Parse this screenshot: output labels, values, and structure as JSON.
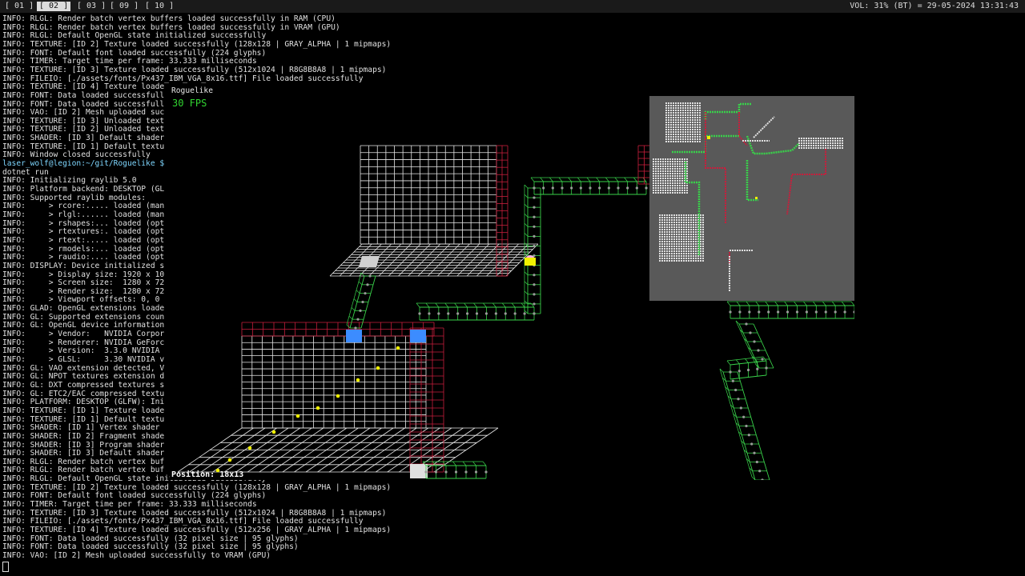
{
  "workspaces": [
    {
      "label": "[ 01 ]",
      "active": false
    },
    {
      "label": "[ 02 ]",
      "active": true
    },
    {
      "label": "[ 03 ]",
      "active": false
    },
    {
      "label": "[ 09 ]",
      "active": false
    },
    {
      "label": "[ 10 ]",
      "active": false
    }
  ],
  "status": "VOL: 31% (BT) = 29-05-2024 13:31:43",
  "terminal": {
    "lines": [
      "INFO: RLGL: Render batch vertex buffers loaded successfully in RAM (CPU)",
      "INFO: RLGL: Render batch vertex buffers loaded successfully in VRAM (GPU)",
      "INFO: RLGL: Default OpenGL state initialized successfully",
      "INFO: TEXTURE: [ID 2] Texture loaded successfully (128x128 | GRAY_ALPHA | 1 mipmaps)",
      "INFO: FONT: Default font loaded successfully (224 glyphs)",
      "INFO: TIMER: Target time per frame: 33.333 milliseconds",
      "INFO: TEXTURE: [ID 3] Texture loaded successfully (512x1024 | R8G8B8A8 | 1 mipmaps)",
      "INFO: FILEIO: [./assets/fonts/Px437_IBM_VGA_8x16.ttf] File loaded successfully",
      "INFO: TEXTURE: [ID 4] Texture loade",
      "INFO: FONT: Data loaded successfull",
      "INFO: FONT: Data loaded successfull",
      "INFO: VAO: [ID 2] Mesh uploaded suc",
      "INFO: TEXTURE: [ID 3] Unloaded text",
      "INFO: TEXTURE: [ID 2] Unloaded text",
      "INFO: SHADER: [ID 3] Default shader",
      "INFO: TEXTURE: [ID 1] Default textu",
      "INFO: Window closed successfully",
      "laser_wolf@legion:~/git/Roguelike $",
      "dotnet run",
      "INFO: Initializing raylib 5.0",
      "INFO: Platform backend: DESKTOP (GL",
      "INFO: Supported raylib modules:",
      "INFO:     > rcore:..... loaded (man",
      "INFO:     > rlgl:...... loaded (man",
      "INFO:     > rshapes:... loaded (opt",
      "INFO:     > rtextures:. loaded (opt",
      "INFO:     > rtext:..... loaded (opt",
      "INFO:     > rmodels:... loaded (opt",
      "INFO:     > raudio:.... loaded (opt",
      "INFO: DISPLAY: Device initialized s",
      "INFO:     > Display size: 1920 x 10",
      "INFO:     > Screen size:  1280 x 72",
      "INFO:     > Render size:  1280 x 72",
      "INFO:     > Viewport offsets: 0, 0",
      "INFO: GLAD: OpenGL extensions loade",
      "INFO: GL: Supported extensions coun",
      "INFO: GL: OpenGL device information",
      "INFO:     > Vendor:   NVIDIA Corpor",
      "INFO:     > Renderer: NVIDIA GeForc",
      "INFO:     > Version:  3.3.0 NVIDIA",
      "INFO:     > GLSL:     3.30 NVIDIA v",
      "INFO: GL: VAO extension detected, V",
      "INFO: GL: NPOT textures extension d",
      "INFO: GL: DXT compressed textures s",
      "INFO: GL: ETC2/EAC compressed textu",
      "INFO: PLATFORM: DESKTOP (GLFW): Ini",
      "INFO: TEXTURE: [ID 1] Texture loade",
      "INFO: TEXTURE: [ID 1] Default textu",
      "INFO: SHADER: [ID 1] Vertex shader",
      "INFO: SHADER: [ID 2] Fragment shade",
      "INFO: SHADER: [ID 3] Program shader",
      "INFO: SHADER: [ID 3] Default shader",
      "INFO: RLGL: Render batch vertex buf",
      "INFO: RLGL: Render batch vertex buf",
      "INFO: RLGL: Default OpenGL state initialized successfully",
      "INFO: TEXTURE: [ID 2] Texture loaded successfully (128x128 | GRAY_ALPHA | 1 mipmaps)",
      "INFO: FONT: Default font loaded successfully (224 glyphs)",
      "INFO: TIMER: Target time per frame: 33.333 milliseconds",
      "INFO: TEXTURE: [ID 3] Texture loaded successfully (512x1024 | R8G8B8A8 | 1 mipmaps)",
      "INFO: FILEIO: [./assets/fonts/Px437_IBM_VGA_8x16.ttf] File loaded successfully",
      "INFO: TEXTURE: [ID 4] Texture loaded successfully (512x256 | GRAY_ALPHA | 1 mipmaps)",
      "INFO: FONT: Data loaded successfully (32 pixel size | 95 glyphs)",
      "INFO: FONT: Data loaded successfully (32 pixel size | 95 glyphs)",
      "INFO: VAO: [ID 2] Mesh uploaded successfully to VRAM (GPU)"
    ]
  },
  "game_window": {
    "title": "Roguelike",
    "fps": "30 FPS",
    "position": "Position: 18x13"
  },
  "colors": {
    "wall": "#e8e8e8",
    "wall_dark": "#c81e3c",
    "corridor": "#39d24a",
    "floor": "#9a9a9a",
    "item": "#f0f000",
    "door": "#3c8cff",
    "minimap_bg": "#595959"
  },
  "icons": [
    "terminal-cursor-icon"
  ]
}
